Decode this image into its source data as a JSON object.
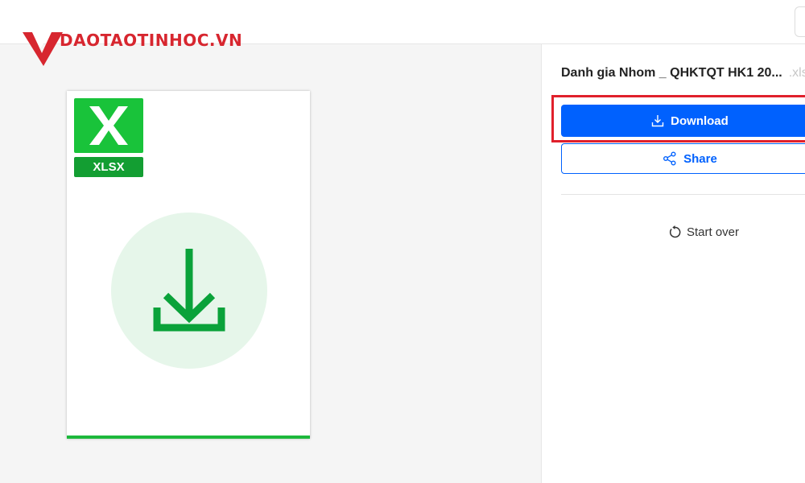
{
  "logo": {
    "text": "DAOTAOTINHOC.VN"
  },
  "preview": {
    "file_type": "XLSX",
    "file_letter": "X",
    "icon": "download-arrow-icon"
  },
  "panel": {
    "file_name": "Danh gia Nhom _ QHKTQT HK1 20...",
    "file_ext": ".xls",
    "download_label": "Download",
    "share_label": "Share",
    "start_over_label": "Start over",
    "icons": {
      "download": "download-icon",
      "share": "share-icon",
      "start_over": "restart-icon"
    }
  },
  "colors": {
    "accent": "#0061fe",
    "excel_green": "#19c33a",
    "excel_dark_green": "#139e32",
    "highlight_red": "#e0202b",
    "logo_red": "#d7262f"
  }
}
